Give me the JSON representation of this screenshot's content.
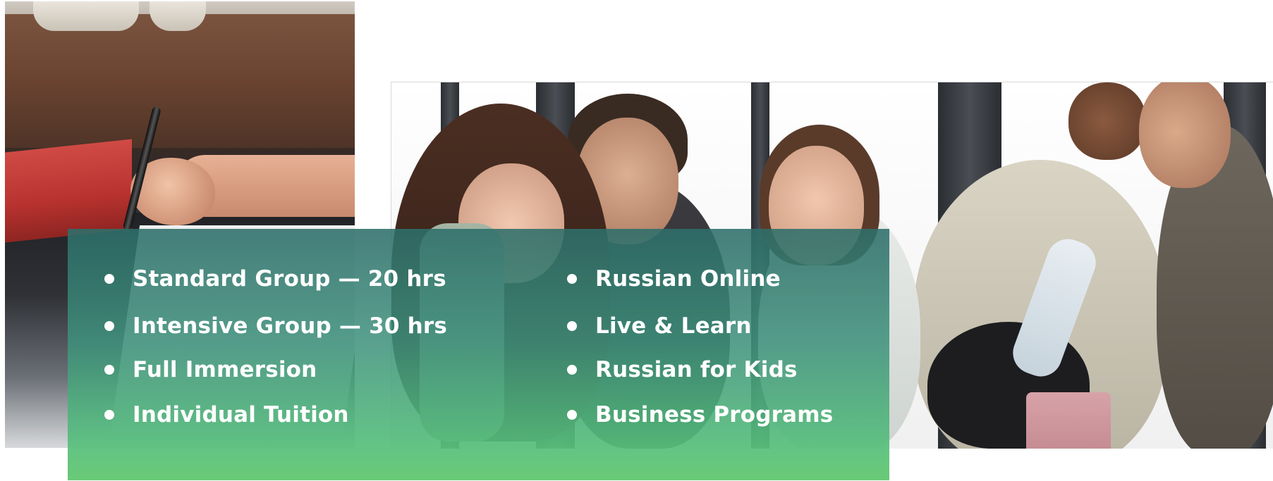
{
  "images": {
    "left_photo": "student-writing-photo",
    "right_photo": "students-group-photo"
  },
  "colors": {
    "overlay_top": "#2e6e6a",
    "overlay_bottom": "#68ca76",
    "text": "#ffffff"
  },
  "courses": {
    "left": [
      {
        "label": "Standard Group — 20 hrs"
      },
      {
        "label": "Intensive Group — 30 hrs"
      },
      {
        "label": "Full Immersion"
      },
      {
        "label": "Individual Tuition"
      }
    ],
    "right": [
      {
        "label": "Russian Online"
      },
      {
        "label": "Live & Learn"
      },
      {
        "label": "Russian for Kids"
      },
      {
        "label": "Business Programs"
      }
    ]
  }
}
